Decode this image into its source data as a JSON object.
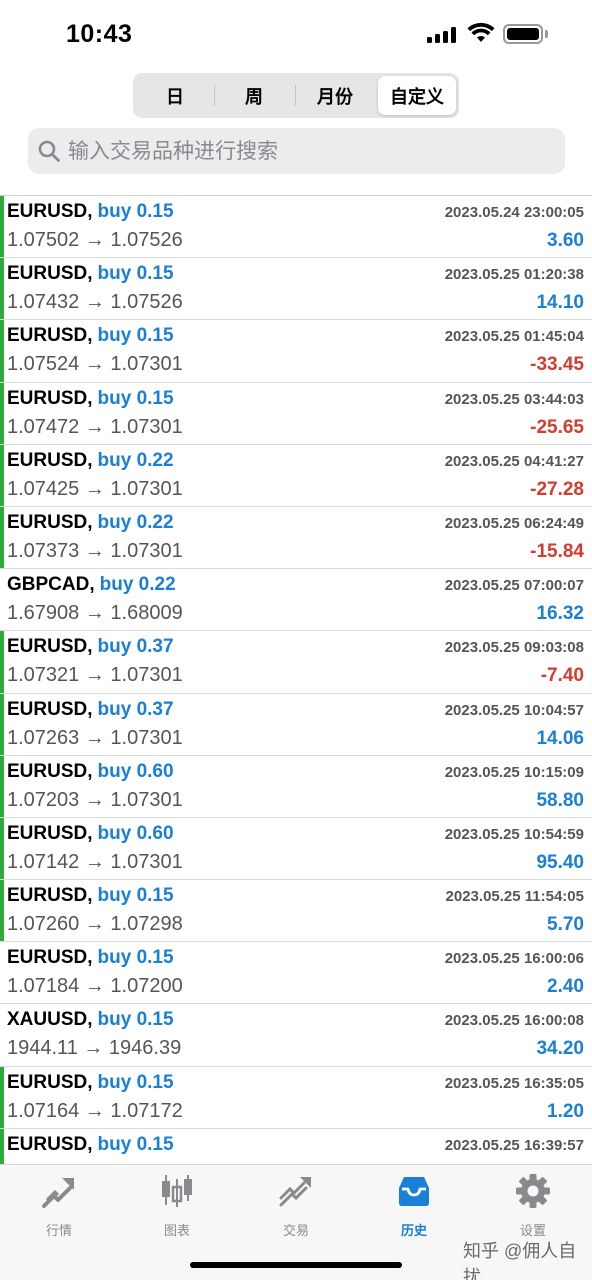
{
  "status_bar": {
    "time": "10:43"
  },
  "period_tabs": [
    {
      "label": "日",
      "active": false
    },
    {
      "label": "周",
      "active": false
    },
    {
      "label": "月份",
      "active": false
    },
    {
      "label": "自定义",
      "active": true
    }
  ],
  "search": {
    "placeholder": "输入交易品种进行搜索"
  },
  "colors": {
    "buy": "#1a7fd6",
    "profit_positive": "#1a7fd6",
    "profit_negative": "#d63b2f",
    "row_marker": "#2dac3c"
  },
  "deals": [
    {
      "symbol": "EURUSD",
      "direction": "buy 0.15",
      "time": "2023.05.24 23:00:05",
      "prices": "1.07502 → 1.07526",
      "profit": "3.60",
      "negative": false,
      "marker": true
    },
    {
      "symbol": "EURUSD",
      "direction": "buy 0.15",
      "time": "2023.05.25 01:20:38",
      "prices": "1.07432 → 1.07526",
      "profit": "14.10",
      "negative": false,
      "marker": true
    },
    {
      "symbol": "EURUSD",
      "direction": "buy 0.15",
      "time": "2023.05.25 01:45:04",
      "prices": "1.07524 → 1.07301",
      "profit": "-33.45",
      "negative": true,
      "marker": true
    },
    {
      "symbol": "EURUSD",
      "direction": "buy 0.15",
      "time": "2023.05.25 03:44:03",
      "prices": "1.07472 → 1.07301",
      "profit": "-25.65",
      "negative": true,
      "marker": true
    },
    {
      "symbol": "EURUSD",
      "direction": "buy 0.22",
      "time": "2023.05.25 04:41:27",
      "prices": "1.07425 → 1.07301",
      "profit": "-27.28",
      "negative": true,
      "marker": true
    },
    {
      "symbol": "EURUSD",
      "direction": "buy 0.22",
      "time": "2023.05.25 06:24:49",
      "prices": "1.07373 → 1.07301",
      "profit": "-15.84",
      "negative": true,
      "marker": true
    },
    {
      "symbol": "GBPCAD",
      "direction": "buy 0.22",
      "time": "2023.05.25 07:00:07",
      "prices": "1.67908 → 1.68009",
      "profit": "16.32",
      "negative": false,
      "marker": false
    },
    {
      "symbol": "EURUSD",
      "direction": "buy 0.37",
      "time": "2023.05.25 09:03:08",
      "prices": "1.07321 → 1.07301",
      "profit": "-7.40",
      "negative": true,
      "marker": true
    },
    {
      "symbol": "EURUSD",
      "direction": "buy 0.37",
      "time": "2023.05.25 10:04:57",
      "prices": "1.07263 → 1.07301",
      "profit": "14.06",
      "negative": false,
      "marker": true
    },
    {
      "symbol": "EURUSD",
      "direction": "buy 0.60",
      "time": "2023.05.25 10:15:09",
      "prices": "1.07203 → 1.07301",
      "profit": "58.80",
      "negative": false,
      "marker": true
    },
    {
      "symbol": "EURUSD",
      "direction": "buy 0.60",
      "time": "2023.05.25 10:54:59",
      "prices": "1.07142 → 1.07301",
      "profit": "95.40",
      "negative": false,
      "marker": true
    },
    {
      "symbol": "EURUSD",
      "direction": "buy 0.15",
      "time": "2023.05.25 11:54:05",
      "prices": "1.07260 → 1.07298",
      "profit": "5.70",
      "negative": false,
      "marker": true
    },
    {
      "symbol": "EURUSD",
      "direction": "buy 0.15",
      "time": "2023.05.25 16:00:06",
      "prices": "1.07184 → 1.07200",
      "profit": "2.40",
      "negative": false,
      "marker": false
    },
    {
      "symbol": "XAUUSD",
      "direction": "buy 0.15",
      "time": "2023.05.25 16:00:08",
      "prices": "1944.11 → 1946.39",
      "profit": "34.20",
      "negative": false,
      "marker": false
    },
    {
      "symbol": "EURUSD",
      "direction": "buy 0.15",
      "time": "2023.05.25 16:35:05",
      "prices": "1.07164 → 1.07172",
      "profit": "1.20",
      "negative": false,
      "marker": true
    },
    {
      "symbol": "EURUSD",
      "direction": "buy 0.15",
      "time": "2023.05.25 16:39:57",
      "prices": "",
      "profit": "",
      "negative": false,
      "marker": true
    }
  ],
  "tab_bar": [
    {
      "label": "行情",
      "icon": "quotes-icon",
      "active": false
    },
    {
      "label": "图表",
      "icon": "chart-icon",
      "active": false
    },
    {
      "label": "交易",
      "icon": "trade-icon",
      "active": false
    },
    {
      "label": "历史",
      "icon": "history-icon",
      "active": true
    },
    {
      "label": "设置",
      "icon": "settings-icon",
      "active": false
    }
  ],
  "watermark": "知乎 @佣人自扰"
}
